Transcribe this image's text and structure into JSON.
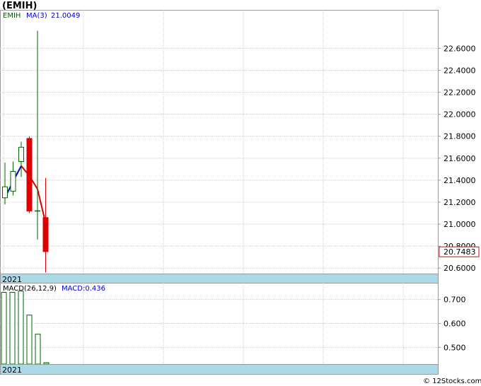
{
  "header": {
    "symbol": "(EMIH)"
  },
  "price_panel": {
    "legend_symbol": "EMIH",
    "ma_label": "MA(3)",
    "ma_value": "21.0049",
    "last_price_label": "20.7483",
    "year_label": "2021"
  },
  "macd_panel": {
    "label": "MACD(26,12,9)",
    "value_label": "MACD:0.436",
    "year_label": "2021"
  },
  "watermark": "© 12Stocks.com",
  "colors": {
    "up": "#ffffff",
    "up_stroke": "#006400",
    "down": "#dd0000",
    "ma_up": "#0000cc",
    "ma_down": "#dd0000",
    "macd": "#006400",
    "date_band": "#add8e6"
  },
  "chart_data": [
    {
      "type": "candlestick",
      "title": "(EMIH)",
      "ylim": [
        20.55,
        22.95
      ],
      "y_ticks": [
        20.6,
        20.8,
        21.0,
        21.2,
        21.4,
        21.6,
        21.8,
        22.0,
        22.2,
        22.4,
        22.6
      ],
      "y_tick_labels": [
        "20.6000",
        "20.8000",
        "21.0000",
        "21.2000",
        "21.4000",
        "21.6000",
        "21.8000",
        "22.0000",
        "22.2000",
        "22.4000",
        "22.6000"
      ],
      "last_price": 20.7483,
      "candles": [
        {
          "open": 21.24,
          "high": 21.56,
          "low": 21.18,
          "close": 21.34
        },
        {
          "open": 21.3,
          "high": 21.57,
          "low": 21.26,
          "close": 21.48
        },
        {
          "open": 21.57,
          "high": 21.75,
          "low": 21.43,
          "close": 21.7
        },
        {
          "open": 21.78,
          "high": 21.8,
          "low": 21.1,
          "close": 21.12
        },
        {
          "open": 21.12,
          "high": 22.76,
          "low": 20.86,
          "close": 21.12
        },
        {
          "open": 21.06,
          "high": 21.42,
          "low": 20.56,
          "close": 20.75
        }
      ],
      "ma": {
        "name": "MA(3)",
        "values": [
          21.24,
          21.39,
          21.53,
          21.44,
          21.32,
          21.01
        ]
      }
    },
    {
      "type": "bar",
      "title": "MACD(26,12,9)",
      "ylim": [
        0.43,
        0.77
      ],
      "y_ticks": [
        0.5,
        0.6,
        0.7
      ],
      "y_tick_labels": [
        "0.500",
        "0.600",
        "0.700"
      ],
      "values": [
        0.73,
        0.73,
        0.735,
        0.635,
        0.555,
        0.436
      ]
    }
  ]
}
